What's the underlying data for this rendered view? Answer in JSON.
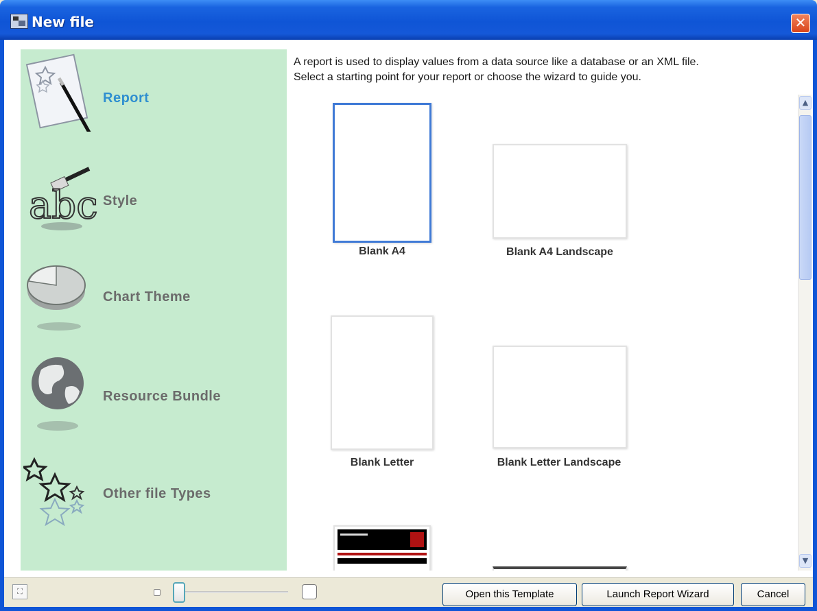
{
  "window": {
    "title": "New file",
    "close_glyph": "✕"
  },
  "categories": [
    {
      "label": "Report",
      "icon": "report-icon",
      "active": true
    },
    {
      "label": "Style",
      "icon": "style-icon",
      "active": false
    },
    {
      "label": "Chart Theme",
      "icon": "chart-theme-icon",
      "active": false
    },
    {
      "label": "Resource Bundle",
      "icon": "globe-icon",
      "active": false
    },
    {
      "label": "Other file Types",
      "icon": "stars-icon",
      "active": false
    }
  ],
  "description": {
    "line1": "A report is used to display values from a data source like a database or an XML file.",
    "line2": "Select a starting point for your report or choose the wizard to guide you."
  },
  "templates": [
    {
      "label": "Blank A4",
      "selected": true
    },
    {
      "label": "Blank A4 Landscape",
      "selected": false
    },
    {
      "label": "Blank Letter",
      "selected": false
    },
    {
      "label": "Blank Letter Landscape",
      "selected": false
    },
    {
      "label": "",
      "selected": false
    }
  ],
  "footer": {
    "open_template": "Open this Template",
    "launch_wizard": "Launch Report Wizard",
    "cancel": "Cancel"
  },
  "colors": {
    "category_bg": "#c6ebcf",
    "active_category": "#2f8fd0",
    "selection_border": "#3f7ad6",
    "titlebar": "#0f55d6"
  }
}
